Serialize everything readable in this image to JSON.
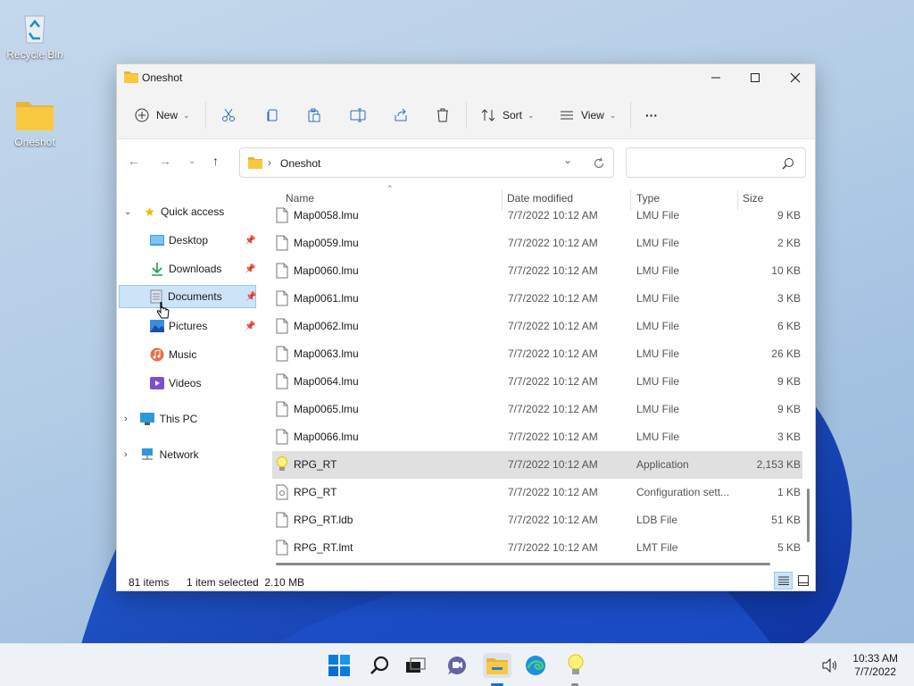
{
  "desktop": {
    "icons": [
      {
        "label": "Recycle Bin"
      },
      {
        "label": "Oneshot"
      }
    ]
  },
  "window": {
    "title": "Oneshot",
    "toolbar": {
      "new_label": "New",
      "sort_label": "Sort",
      "view_label": "View",
      "more_label": "···"
    },
    "address": {
      "path_separator": "›",
      "current_folder": "Oneshot",
      "search_placeholder": ""
    },
    "nav": {
      "quick_access": "Quick access",
      "items": [
        {
          "label": "Desktop",
          "pinned": true
        },
        {
          "label": "Downloads",
          "pinned": true
        },
        {
          "label": "Documents",
          "pinned": true,
          "selected": true
        },
        {
          "label": "Pictures",
          "pinned": true
        },
        {
          "label": "Music",
          "pinned": false
        },
        {
          "label": "Videos",
          "pinned": false
        }
      ],
      "this_pc": "This PC",
      "network": "Network"
    },
    "columns": {
      "name": "Name",
      "date": "Date modified",
      "type": "Type",
      "size": "Size"
    },
    "files": [
      {
        "name": "Map0058.lmu",
        "date": "7/7/2022 10:12 AM",
        "type": "LMU File",
        "size": "9 KB"
      },
      {
        "name": "Map0059.lmu",
        "date": "7/7/2022 10:12 AM",
        "type": "LMU File",
        "size": "2 KB"
      },
      {
        "name": "Map0060.lmu",
        "date": "7/7/2022 10:12 AM",
        "type": "LMU File",
        "size": "10 KB"
      },
      {
        "name": "Map0061.lmu",
        "date": "7/7/2022 10:12 AM",
        "type": "LMU File",
        "size": "3 KB"
      },
      {
        "name": "Map0062.lmu",
        "date": "7/7/2022 10:12 AM",
        "type": "LMU File",
        "size": "6 KB"
      },
      {
        "name": "Map0063.lmu",
        "date": "7/7/2022 10:12 AM",
        "type": "LMU File",
        "size": "26 KB"
      },
      {
        "name": "Map0064.lmu",
        "date": "7/7/2022 10:12 AM",
        "type": "LMU File",
        "size": "9 KB"
      },
      {
        "name": "Map0065.lmu",
        "date": "7/7/2022 10:12 AM",
        "type": "LMU File",
        "size": "9 KB"
      },
      {
        "name": "Map0066.lmu",
        "date": "7/7/2022 10:12 AM",
        "type": "LMU File",
        "size": "3 KB"
      },
      {
        "name": "RPG_RT",
        "date": "7/7/2022 10:12 AM",
        "type": "Application",
        "size": "2,153 KB"
      },
      {
        "name": "RPG_RT",
        "date": "7/7/2022 10:12 AM",
        "type": "Configuration sett...",
        "size": "1 KB"
      },
      {
        "name": "RPG_RT.ldb",
        "date": "7/7/2022 10:12 AM",
        "type": "LDB File",
        "size": "51 KB"
      },
      {
        "name": "RPG_RT.lmt",
        "date": "7/7/2022 10:12 AM",
        "type": "LMT File",
        "size": "5 KB"
      }
    ],
    "status": {
      "item_count": "81 items",
      "selection": "1 item selected  2.10 MB"
    }
  },
  "taskbar": {
    "time": "10:33 AM",
    "date": "7/7/2022"
  },
  "colors": {
    "accent": "#0078d4",
    "folder": "#f8c940",
    "selected_nav": "#cce4f7",
    "selected_row": "#e0e0e0"
  }
}
